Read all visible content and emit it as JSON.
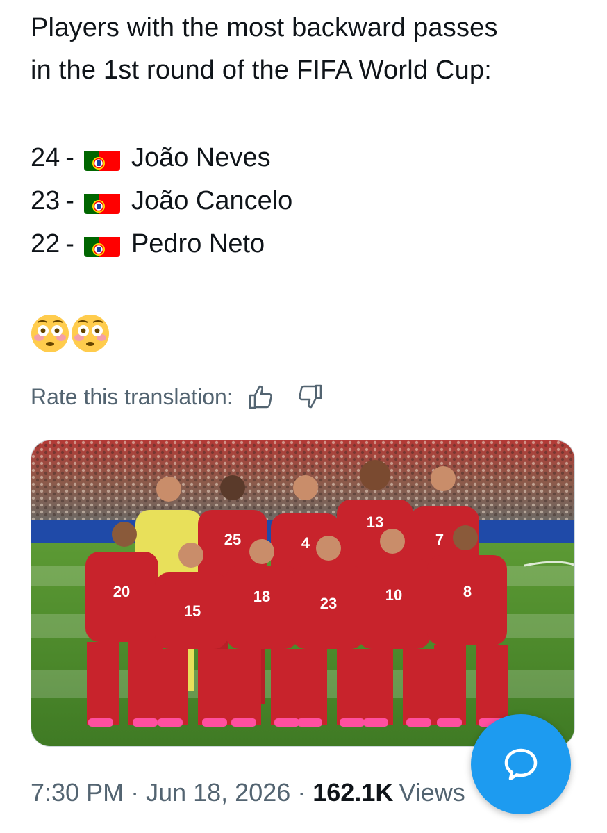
{
  "post": {
    "headline_line1": "Players with the most backward passes",
    "headline_line2": "in the 1st round of the FIFA World Cup:",
    "rankings": [
      {
        "count": "24",
        "dash": "-",
        "flag": "portugal-flag",
        "name": "João Neves"
      },
      {
        "count": "23",
        "dash": "-",
        "flag": "portugal-flag",
        "name": "João Cancelo"
      },
      {
        "count": "22",
        "dash": "-",
        "flag": "portugal-flag",
        "name": "Pedro Neto"
      }
    ],
    "emoji": [
      "flushed-face",
      "flushed-face"
    ]
  },
  "translation": {
    "rate_label": "Rate this translation:",
    "icons": [
      "thumbs-up-icon",
      "thumbs-down-icon"
    ]
  },
  "media": {
    "description_icon": "team-photo",
    "jersey_numbers_back": [
      "25",
      "4",
      "13",
      "7"
    ],
    "jersey_numbers_front": [
      "20",
      "15",
      "18",
      "23",
      "10",
      "8"
    ]
  },
  "meta": {
    "time": "7:30 PM",
    "separator": "·",
    "date": "Jun 18, 2026",
    "views_count": "162.1K",
    "views_label": "Views"
  },
  "fab": {
    "icon": "reply-bubble-icon"
  },
  "colors": {
    "text_primary": "#0f1419",
    "text_secondary": "#536471",
    "accent": "#1d9bf0",
    "jersey_red": "#c8232c",
    "pitch_green": "#4f8a2e"
  }
}
